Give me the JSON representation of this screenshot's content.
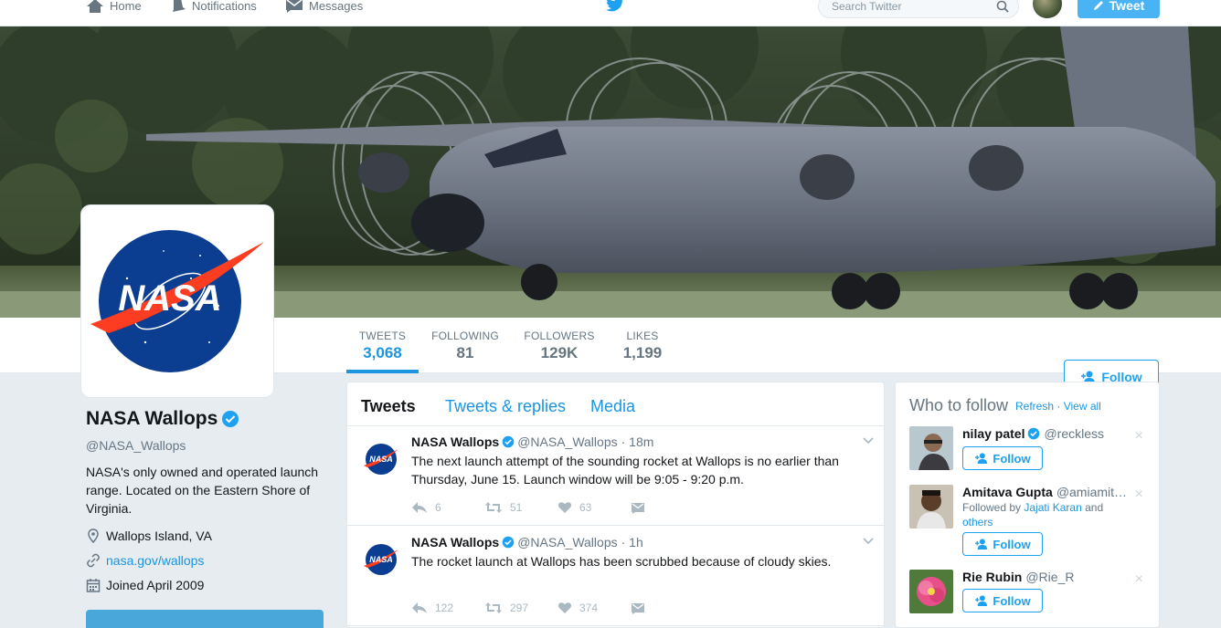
{
  "nav": {
    "home": "Home",
    "notifications": "Notifications",
    "messages": "Messages",
    "search_placeholder": "Search Twitter",
    "tweet_button": "Tweet"
  },
  "stats": [
    {
      "label": "TWEETS",
      "value": "3,068"
    },
    {
      "label": "FOLLOWING",
      "value": "81"
    },
    {
      "label": "FOLLOWERS",
      "value": "129K"
    },
    {
      "label": "LIKES",
      "value": "1,199"
    }
  ],
  "follow_button": "Follow",
  "profile": {
    "name": "NASA Wallops",
    "handle": "@NASA_Wallops",
    "bio": "NASA's only owned and operated launch range. Located on the Eastern Shore of Virginia.",
    "location": "Wallops Island, VA",
    "website": "nasa.gov/wallops",
    "joined": "Joined April 2009",
    "logo_text": "NASA"
  },
  "timeline": {
    "tabs": [
      "Tweets",
      "Tweets & replies",
      "Media"
    ],
    "tweets": [
      {
        "name": "NASA Wallops",
        "handle": "@NASA_Wallops",
        "time": "· 18m",
        "text": "The next launch attempt of the sounding rocket at Wallops is no earlier than Thursday, June 15.  Launch window will be 9:05 - 9:20 p.m.",
        "replies": "6",
        "retweets": "51",
        "likes": "63"
      },
      {
        "name": "NASA Wallops",
        "handle": "@NASA_Wallops",
        "time": "· 1h",
        "text": "The rocket launch at Wallops has been scrubbed because of cloudy skies.",
        "replies": "122",
        "retweets": "297",
        "likes": "374"
      }
    ]
  },
  "who_to_follow": {
    "title": "Who to follow",
    "refresh": "Refresh",
    "sep": "·",
    "view_all": "View all",
    "users": [
      {
        "name": "nilay patel",
        "handle": "@reckless",
        "verified": true,
        "follow": "Follow"
      },
      {
        "name": "Amitava Gupta",
        "handle": "@amiamit…",
        "verified": false,
        "followed_by_prefix": "Followed by",
        "followed_by_name": "Jajati Karan",
        "followed_by_and": "and",
        "followed_by_others": "others",
        "follow": "Follow"
      },
      {
        "name": "Rie Rubin",
        "handle": "@Rie_R",
        "verified": false,
        "follow": "Follow"
      }
    ]
  },
  "colors": {
    "accent": "#1da1f2",
    "link": "#1b95e0",
    "background": "#e6ecf0"
  }
}
